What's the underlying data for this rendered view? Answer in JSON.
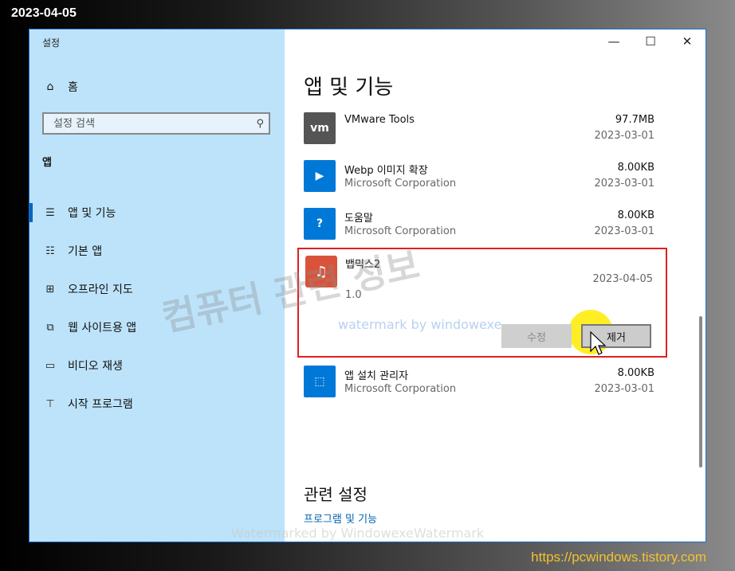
{
  "date_stamp": "2023-04-05",
  "window": {
    "app_title": "설정",
    "controls": {
      "minimize": "—",
      "maximize": "☐",
      "close": "✕"
    }
  },
  "sidebar": {
    "home_label": "홈",
    "search_placeholder": "설정 검색",
    "section_label": "앱",
    "items": [
      {
        "label": "앱 및 기능",
        "icon": "apps-features-icon",
        "active": true
      },
      {
        "label": "기본 앱",
        "icon": "default-apps-icon",
        "active": false
      },
      {
        "label": "오프라인 지도",
        "icon": "offline-maps-icon",
        "active": false
      },
      {
        "label": "웹 사이트용 앱",
        "icon": "apps-for-websites-icon",
        "active": false
      },
      {
        "label": "비디오 재생",
        "icon": "video-playback-icon",
        "active": false
      },
      {
        "label": "시작 프로그램",
        "icon": "startup-icon",
        "active": false
      }
    ]
  },
  "main": {
    "title": "앱 및 기능",
    "apps": [
      {
        "name": "VMware Tools",
        "publisher": "",
        "size": "97.7MB",
        "date": "2023-03-01",
        "icon": "vmware-icon",
        "tile_text": "vm",
        "tile_color": "#555555"
      },
      {
        "name": "Webp 이미지 확장",
        "publisher": "Microsoft Corporation",
        "size": "8.00KB",
        "date": "2023-03-01",
        "icon": "webp-extension-icon",
        "tile_text": "▶",
        "tile_color": "#0078d7"
      },
      {
        "name": "도움말",
        "publisher": "Microsoft Corporation",
        "size": "8.00KB",
        "date": "2023-03-01",
        "icon": "help-icon",
        "tile_text": "?",
        "tile_color": "#0078d7"
      }
    ],
    "selected_app": {
      "name": "뱁믹스2",
      "date": "2023-04-05",
      "version": "1.0",
      "icon": "bandimix-icon",
      "modify_label": "수정",
      "uninstall_label": "제거"
    },
    "apps_after": [
      {
        "name": "앱 설치 관리자",
        "publisher": "Microsoft Corporation",
        "size": "8.00KB",
        "date": "2023-03-01",
        "icon": "app-installer-icon",
        "tile_text": "⬚",
        "tile_color": "#0078d7"
      }
    ],
    "related_title": "관련 설정",
    "related_link": "프로그램 및 기능"
  },
  "watermarks": {
    "big": "컴퓨터 관련 정보",
    "small": "watermark by windowexe",
    "bottom": "Watermarked by WindowexeWatermark"
  },
  "site_url": "https://pcwindows.tistory.com"
}
